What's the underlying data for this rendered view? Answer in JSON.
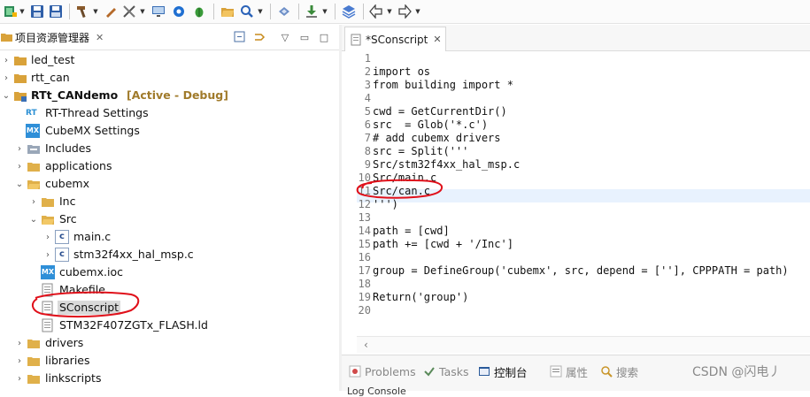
{
  "toolbar": {
    "buttons": [
      "new-icon",
      "save-icon",
      "save-all-icon",
      "build-hammer-icon",
      "wrench-icon",
      "tools-icon",
      "monitor-icon",
      "gear-icon",
      "debug-bug-icon",
      "open-folder-icon",
      "search-icon",
      "package-icon",
      "download-icon",
      "layers-icon",
      "back-arrow-icon",
      "forward-arrow-icon"
    ]
  },
  "project_explorer": {
    "title": "项目资源管理器",
    "close": "✕"
  },
  "tree": [
    {
      "label": "led_test"
    },
    {
      "label": "rtt_can"
    },
    {
      "label": "RTt_CANdemo",
      "decoration": "[Active - Debug]"
    },
    {
      "label": "RT-Thread Settings",
      "icon_text": "RT"
    },
    {
      "label": "CubeMX Settings",
      "icon_text": "MX"
    },
    {
      "label": "Includes"
    },
    {
      "label": "applications"
    },
    {
      "label": "cubemx"
    },
    {
      "label": "Inc"
    },
    {
      "label": "Src"
    },
    {
      "label": "main.c",
      "icon_text": "c"
    },
    {
      "label": "stm32f4xx_hal_msp.c",
      "icon_text": "c"
    },
    {
      "label": "cubemx.ioc",
      "icon_text": "MX"
    },
    {
      "label": "Makefile"
    },
    {
      "label": "SConscript"
    },
    {
      "label": "STM32F407ZGTx_FLASH.ld"
    },
    {
      "label": "drivers"
    },
    {
      "label": "libraries"
    },
    {
      "label": "linkscripts"
    }
  ],
  "editor": {
    "tab_title": "*SConscript",
    "tab_close": "✕",
    "lines": [
      {
        "n": "1",
        "text": ""
      },
      {
        "n": "2",
        "text": "import os"
      },
      {
        "n": "3",
        "text": "from building import *"
      },
      {
        "n": "4",
        "text": ""
      },
      {
        "n": "5",
        "text": "cwd = GetCurrentDir()"
      },
      {
        "n": "6",
        "text": "src  = Glob('*.c')"
      },
      {
        "n": "7",
        "text": "# add cubemx drivers"
      },
      {
        "n": "8",
        "text": "src = Split('''"
      },
      {
        "n": "9",
        "text": "Src/stm32f4xx_hal_msp.c"
      },
      {
        "n": "10",
        "text": "Src/main.c"
      },
      {
        "n": "11",
        "text": "Src/can.c"
      },
      {
        "n": "12",
        "text": "''')"
      },
      {
        "n": "13",
        "text": ""
      },
      {
        "n": "14",
        "text": "path = [cwd]"
      },
      {
        "n": "15",
        "text": "path += [cwd + '/Inc']"
      },
      {
        "n": "16",
        "text": ""
      },
      {
        "n": "17",
        "text": "group = DefineGroup('cubemx', src, depend = [''], CPPPATH = path)"
      },
      {
        "n": "18",
        "text": ""
      },
      {
        "n": "19",
        "text": "Return('group')"
      },
      {
        "n": "20",
        "text": ""
      }
    ]
  },
  "bottom_panel": {
    "tabs": [
      {
        "label": "Problems"
      },
      {
        "label": "Tasks"
      },
      {
        "label": "控制台"
      },
      {
        "label": "属性"
      },
      {
        "label": "搜索"
      }
    ],
    "sub_label": "Log Console"
  },
  "watermark": "CSDN @闪电丿",
  "colors": {
    "annotation": "#e0101a",
    "current_line": "#e8f2fe",
    "active_decoration": "#a07a2a"
  }
}
